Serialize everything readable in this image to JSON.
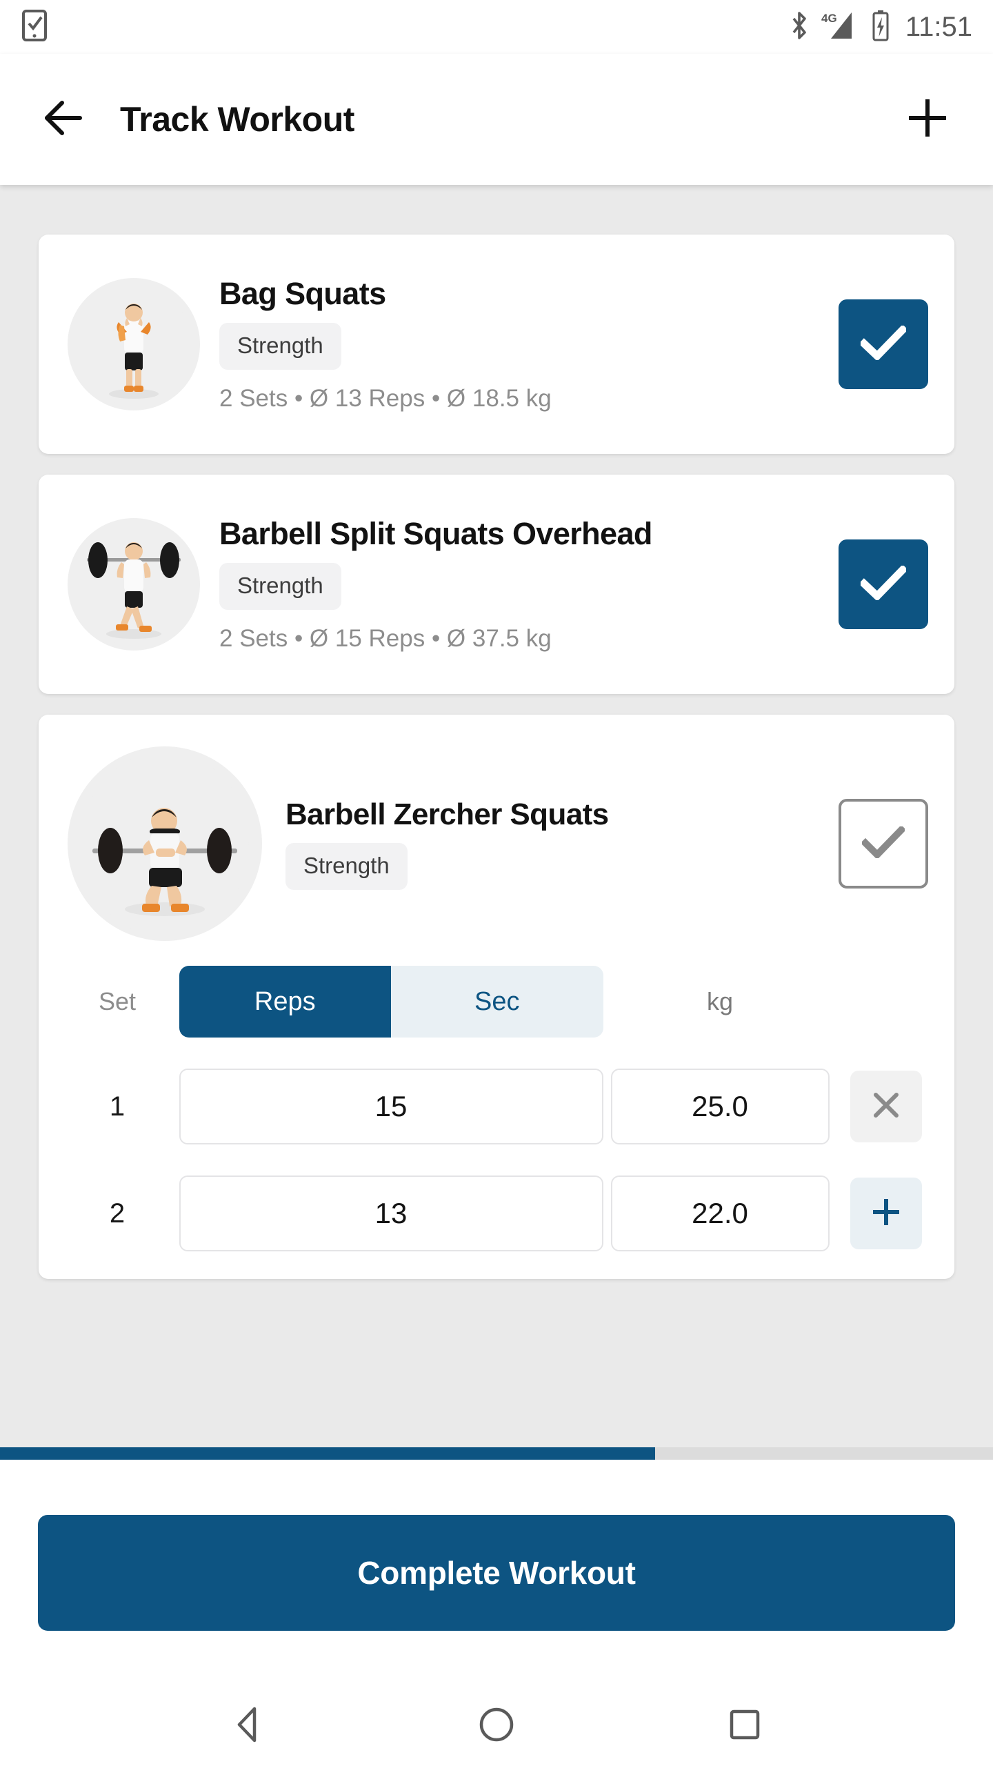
{
  "status_bar": {
    "left_icon": "phone-check-icon",
    "icons": [
      "bluetooth-icon",
      "signal-4g-icon",
      "battery-charging-icon"
    ],
    "network_label": "4G",
    "clock": "11:51"
  },
  "app_bar": {
    "back_icon": "arrow-left-icon",
    "title": "Track Workout",
    "add_icon": "plus-icon"
  },
  "theme": {
    "accent": "#0d5482",
    "accent_light": "#e9f0f4",
    "page_bg": "#eaeaea",
    "card_bg": "#ffffff",
    "muted_text": "#8d8d8d",
    "chip_bg": "#f2f2f3"
  },
  "exercises": [
    {
      "name": "Bag Squats",
      "category": "Strength",
      "summary": "2 Sets • Ø 13 Reps • Ø 18.5 kg",
      "sets": "2 Sets",
      "avg_reps": "Ø 13 Reps",
      "avg_weight": "Ø 18.5 kg",
      "completed": true,
      "expanded": false,
      "thumbnail": "athlete-bag-squat-image"
    },
    {
      "name": "Barbell Split Squats Overhead",
      "category": "Strength",
      "summary": "2 Sets • Ø 15 Reps • Ø 37.5 kg",
      "sets": "2 Sets",
      "avg_reps": "Ø 15 Reps",
      "avg_weight": "Ø 37.5 kg",
      "completed": true,
      "expanded": false,
      "thumbnail": "athlete-barbell-split-squat-image"
    },
    {
      "name": "Barbell Zercher Squats",
      "category": "Strength",
      "completed": false,
      "expanded": true,
      "thumbnail": "athlete-zercher-squat-image",
      "table": {
        "header_set": "Set",
        "header_unit": "kg",
        "toggle": {
          "options": [
            "Reps",
            "Sec"
          ],
          "selected": "Reps"
        },
        "rows": [
          {
            "set": "1",
            "reps": "15",
            "weight": "25.0",
            "action": "remove"
          },
          {
            "set": "2",
            "reps": "13",
            "weight": "22.0",
            "action": "add"
          }
        ]
      }
    }
  ],
  "progress": {
    "percent": 66
  },
  "footer": {
    "complete_label": "Complete Workout"
  },
  "nav_bar": {
    "back": "nav-back-icon",
    "home": "nav-home-icon",
    "recents": "nav-recents-icon"
  }
}
